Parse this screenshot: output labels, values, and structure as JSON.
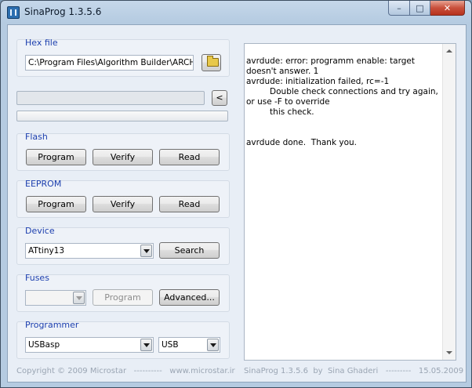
{
  "window": {
    "title": "SinaProg 1.3.5.6"
  },
  "caption": {
    "minimize": "–",
    "maximize": "□",
    "close": "✕"
  },
  "hexfile": {
    "title": "Hex file",
    "path": "C:\\Program Files\\Algorithm Builder\\ARCHIV\\",
    "browse_icon": "folder-open-icon"
  },
  "progress": {
    "collapse_label": "<",
    "value_1": 0,
    "value_2": 0
  },
  "flash": {
    "title": "Flash",
    "program": "Program",
    "verify": "Verify",
    "read": "Read"
  },
  "eeprom": {
    "title": "EEPROM",
    "program": "Program",
    "verify": "Verify",
    "read": "Read"
  },
  "device": {
    "title": "Device",
    "selected": "ATtiny13",
    "search": "Search"
  },
  "fuses": {
    "title": "Fuses",
    "selected": "",
    "program": "Program",
    "advanced": "Advanced..."
  },
  "programmer": {
    "title": "Programmer",
    "selected": "USBasp",
    "port": "USB"
  },
  "log": {
    "text": "avrdude: error: programm enable: target doesn't answer. 1\navrdude: initialization failed, rc=-1\n         Double check connections and try again, or use -F to override\n         this check.\n\n\navrdude done.  Thank you."
  },
  "footer": {
    "left": "Copyright © 2009 Microstar   ----------   www.microstar.ir",
    "right": "SinaProg 1.3.5.6  by  Sina Ghaderi   ---------   15.05.2009"
  },
  "colors": {
    "group_title": "#1c3fae",
    "footer_text": "#9aa5b3"
  }
}
